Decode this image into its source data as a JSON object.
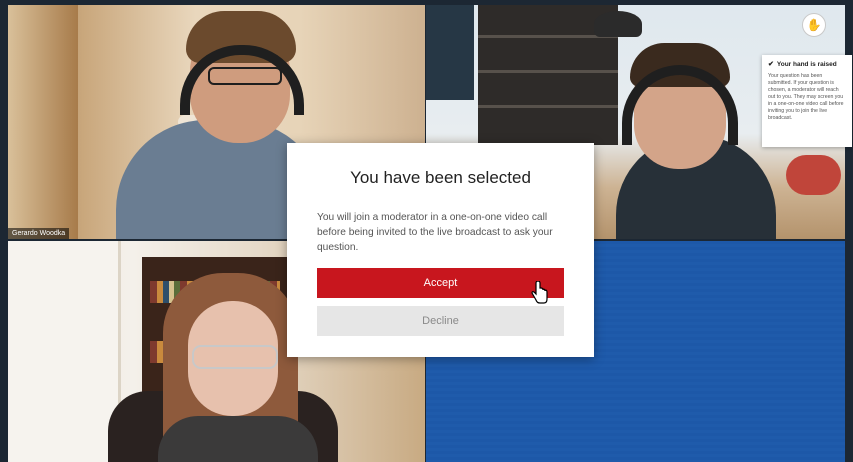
{
  "participants": [
    {
      "name": "Gerardo Woodka"
    }
  ],
  "raise_hand": {
    "icon": "hand-raised-icon"
  },
  "hand_toast": {
    "title": "Your hand is raised",
    "body": "Your question has been submitted. If your question is chosen, a moderator will reach out to you. They may screen you in a one-on-one video call before inviting you to join the live broadcast."
  },
  "dialog": {
    "title": "You have been selected",
    "message": "You will join a moderator in a one-on-one video call before being invited to the live broadcast to ask your question.",
    "accept_label": "Accept",
    "decline_label": "Decline"
  },
  "colors": {
    "accept": "#c8161e",
    "broadcast_background": "#1d58a8"
  }
}
